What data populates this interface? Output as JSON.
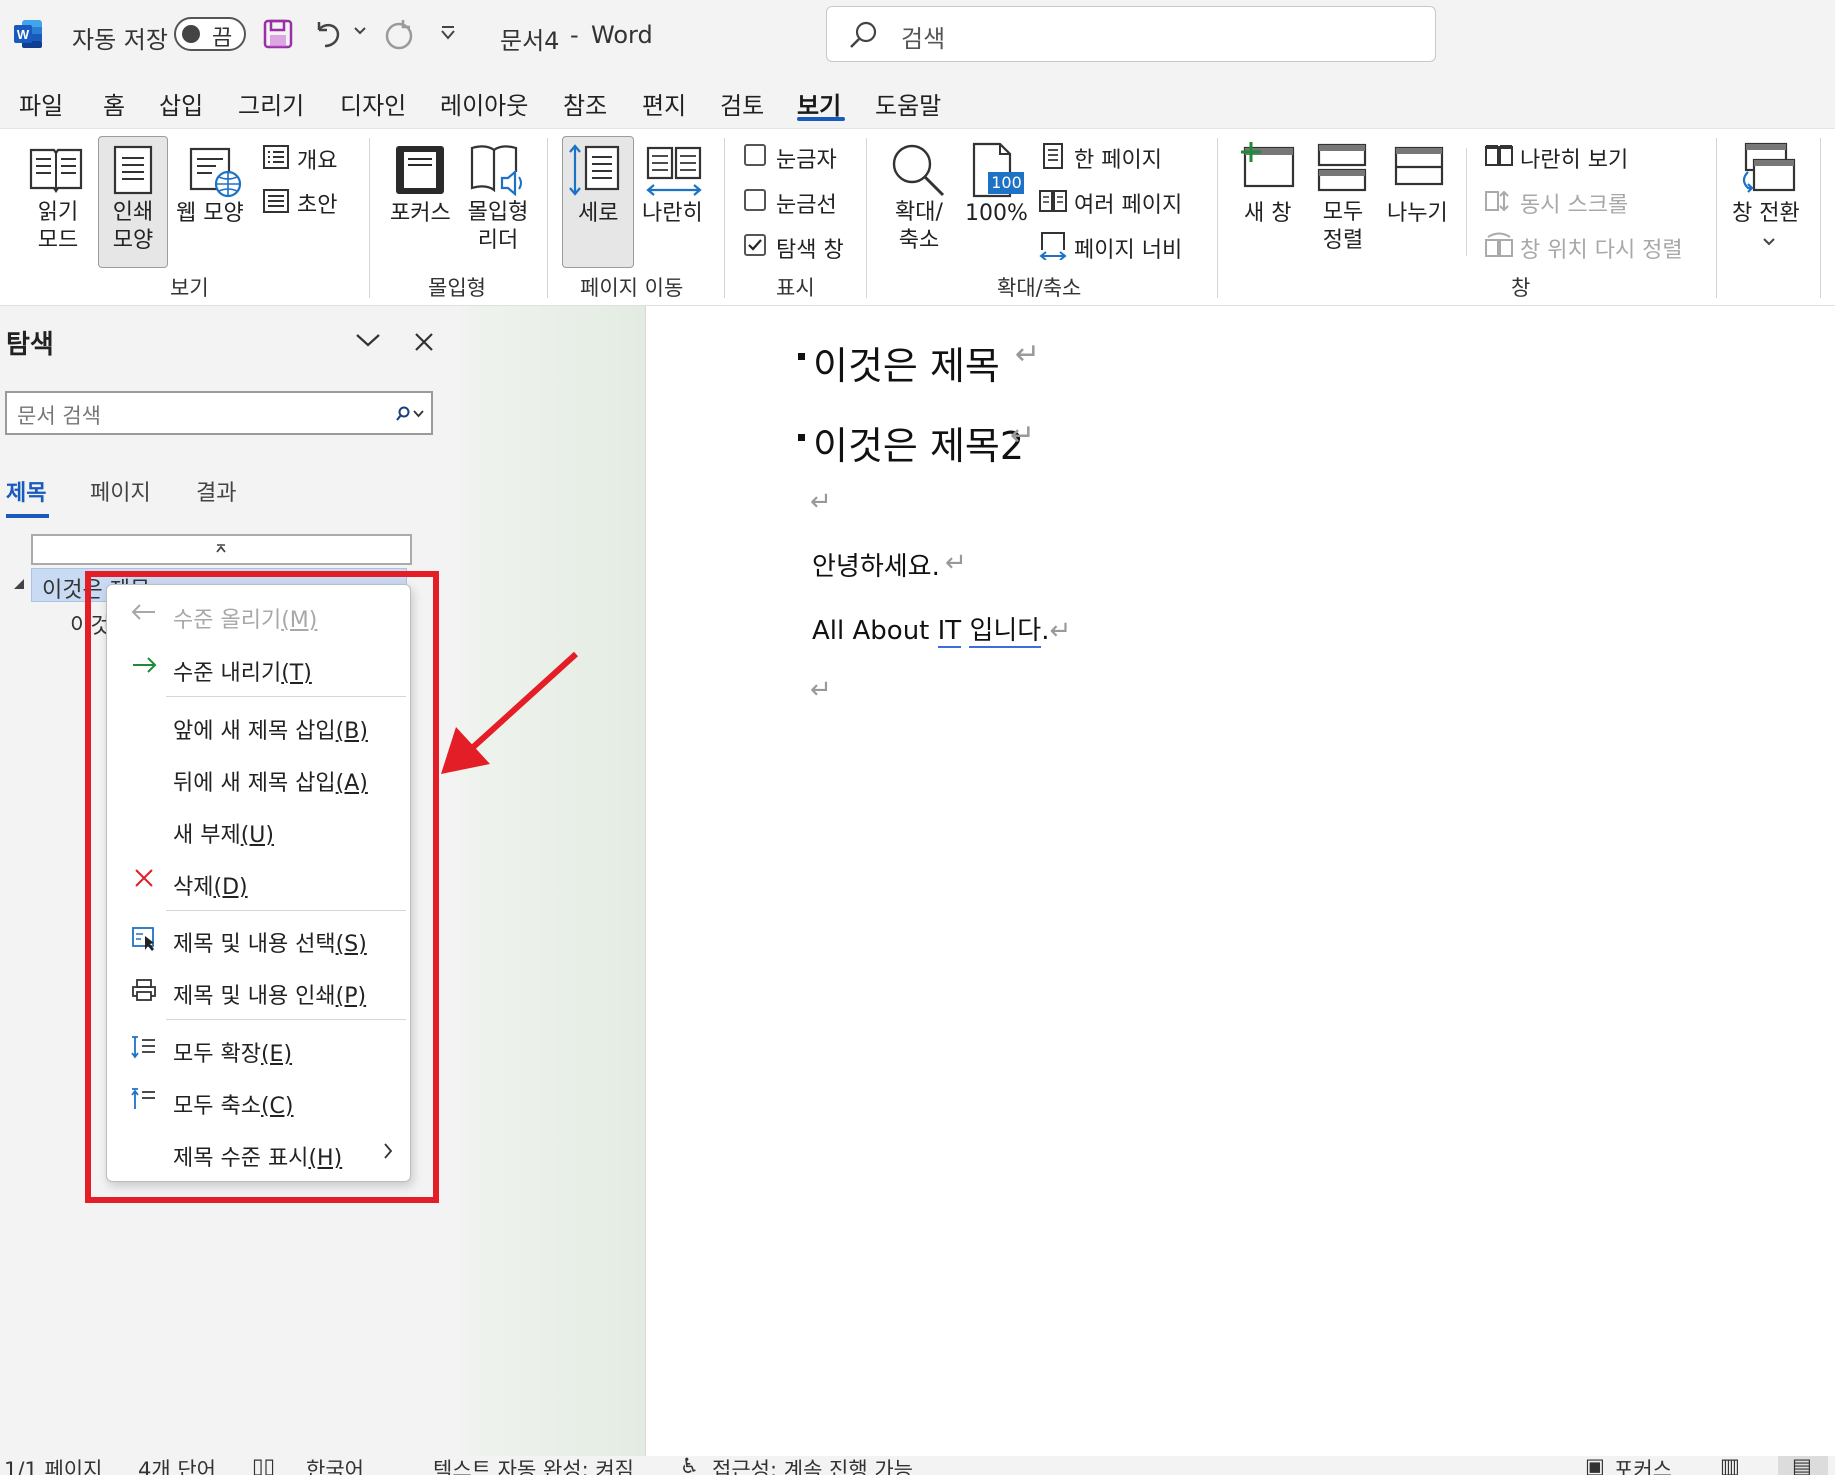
{
  "titlebar": {
    "app_icon": "word-logo-icon",
    "autosave_label": "자동 저장",
    "autosave_state": "끔",
    "doc_title": "문서4",
    "title_separator": "-",
    "app_name": "Word",
    "search_placeholder": "검색"
  },
  "ribbon_tabs": [
    "파일",
    "홈",
    "삽입",
    "그리기",
    "디자인",
    "레이아웃",
    "참조",
    "편지",
    "검토",
    "보기",
    "도움말"
  ],
  "active_tab": "보기",
  "ribbon": {
    "view": {
      "read_mode": [
        "읽기",
        "모드"
      ],
      "print_layout": [
        "인쇄",
        "모양"
      ],
      "web_layout": "웹 모양",
      "outline": "개요",
      "draft": "초안",
      "group": "보기"
    },
    "immersive": {
      "focus": "포커스",
      "immersive_reader": [
        "몰입형",
        "리더"
      ],
      "group": "몰입형"
    },
    "page_movement": {
      "vertical": "세로",
      "side_to_side": "나란히",
      "group": "페이지 이동"
    },
    "show": {
      "ruler": "눈금자",
      "gridlines": "눈금선",
      "nav_pane": "탐색 창",
      "group": "표시",
      "nav_pane_checked": true
    },
    "zoom": {
      "zoom": [
        "확대/",
        "축소"
      ],
      "hundred": "100%",
      "hundred_icon_text": "100",
      "one_page": "한 페이지",
      "multiple_pages": "여러 페이지",
      "page_width": "페이지 너비",
      "group": "확대/축소"
    },
    "window": {
      "new_window": "새 창",
      "arrange_all": [
        "모두",
        "정렬"
      ],
      "split": "나누기",
      "side_by_side": "나란히 보기",
      "sync_scroll": "동시 스크롤",
      "reset_position": "창 위치 다시 정렬",
      "switch_windows": "창 전환",
      "group": "창"
    }
  },
  "nav_pane": {
    "title": "탐색",
    "search_placeholder": "문서 검색",
    "tabs": [
      "제목",
      "페이지",
      "결과"
    ],
    "active_tab": "제목",
    "headings": [
      "이것은 제목",
      "이것은 제목2"
    ]
  },
  "context_menu": {
    "items": [
      {
        "label": "수준 올리기",
        "key": "(M)",
        "icon": "arrow-left-icon",
        "disabled": true
      },
      {
        "label": "수준 내리기",
        "key": "(T)",
        "icon": "arrow-right-icon",
        "disabled": false
      },
      {
        "label": "앞에 새 제목 삽입",
        "key": "(B)",
        "icon": "",
        "disabled": false
      },
      {
        "label": "뒤에 새 제목 삽입",
        "key": "(A)",
        "icon": "",
        "disabled": false
      },
      {
        "label": "새 부제",
        "key": "(U)",
        "icon": "",
        "disabled": false
      },
      {
        "label": "삭제",
        "key": "(D)",
        "icon": "delete-x-icon",
        "disabled": false
      },
      {
        "label": "제목 및 내용 선택",
        "key": "(S)",
        "icon": "select-content-icon",
        "disabled": false
      },
      {
        "label": "제목 및 내용 인쇄",
        "key": "(P)",
        "icon": "printer-icon",
        "disabled": false
      },
      {
        "label": "모두 확장",
        "key": "(E)",
        "icon": "expand-all-icon",
        "disabled": false
      },
      {
        "label": "모두 축소",
        "key": "(C)",
        "icon": "collapse-all-icon",
        "disabled": false
      },
      {
        "label": "제목 수준 표시",
        "key": "(H)",
        "icon": "",
        "disabled": false,
        "submenu": true
      }
    ],
    "highlight_color": "#e41e26"
  },
  "document": {
    "heading1": "이것은 제목",
    "heading2": "이것은 제목2",
    "para_greeting": "안녕하세요.",
    "para_all_about": "All About",
    "para_it": "IT",
    "para_ipnida": "입니다",
    "para_period": ".",
    "pilcrow": "↵"
  },
  "statusbar": {
    "page": "1/1 페이지",
    "words": "4개 단어",
    "language": "한국어",
    "text_predictions": "텍스트 자동 완성: 켜짐",
    "accessibility": "접근성: 계속 진행 가능",
    "focus": "포커스"
  },
  "colors": {
    "accent": "#185abd",
    "annotation_red": "#e41e26",
    "nav_selected": "#c9daf3"
  }
}
